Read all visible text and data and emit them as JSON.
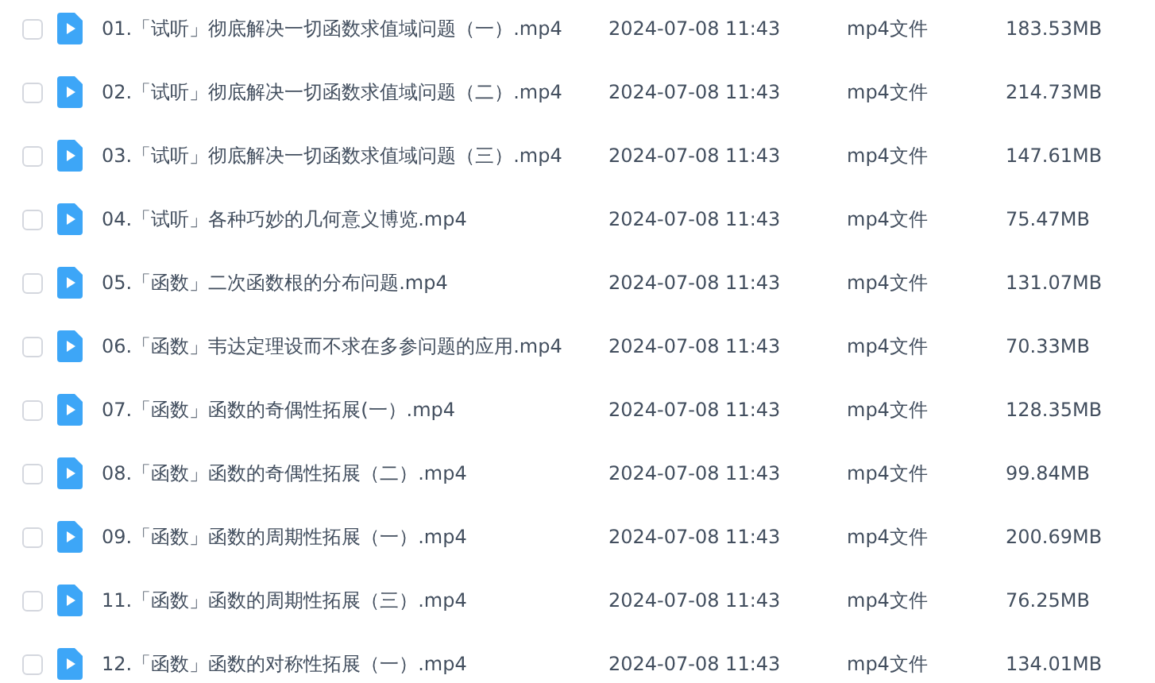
{
  "files": [
    {
      "checked": false,
      "name": "01.「试听」彻底解决一切函数求值域问题（一）.mp4",
      "modified": "2024-07-08 11:43",
      "type": "mp4文件",
      "size": "183.53MB"
    },
    {
      "checked": false,
      "name": "02.「试听」彻底解决一切函数求值域问题（二）.mp4",
      "modified": "2024-07-08 11:43",
      "type": "mp4文件",
      "size": "214.73MB"
    },
    {
      "checked": false,
      "name": "03.「试听」彻底解决一切函数求值域问题（三）.mp4",
      "modified": "2024-07-08 11:43",
      "type": "mp4文件",
      "size": "147.61MB"
    },
    {
      "checked": false,
      "name": "04.「试听」各种巧妙的几何意义博览.mp4",
      "modified": "2024-07-08 11:43",
      "type": "mp4文件",
      "size": "75.47MB"
    },
    {
      "checked": false,
      "name": "05.「函数」二次函数根的分布问题.mp4",
      "modified": "2024-07-08 11:43",
      "type": "mp4文件",
      "size": "131.07MB"
    },
    {
      "checked": false,
      "name": "06.「函数」韦达定理设而不求在多参问题的应用.mp4",
      "modified": "2024-07-08 11:43",
      "type": "mp4文件",
      "size": "70.33MB"
    },
    {
      "checked": false,
      "name": "07.「函数」函数的奇偶性拓展(一）.mp4",
      "modified": "2024-07-08 11:43",
      "type": "mp4文件",
      "size": "128.35MB"
    },
    {
      "checked": false,
      "name": "08.「函数」函数的奇偶性拓展（二）.mp4",
      "modified": "2024-07-08 11:43",
      "type": "mp4文件",
      "size": "99.84MB"
    },
    {
      "checked": false,
      "name": "09.「函数」函数的周期性拓展（一）.mp4",
      "modified": "2024-07-08 11:43",
      "type": "mp4文件",
      "size": "200.69MB"
    },
    {
      "checked": false,
      "name": "11.「函数」函数的周期性拓展（三）.mp4",
      "modified": "2024-07-08 11:43",
      "type": "mp4文件",
      "size": "76.25MB"
    },
    {
      "checked": false,
      "name": "12.「函数」函数的对称性拓展（一）.mp4",
      "modified": "2024-07-08 11:43",
      "type": "mp4文件",
      "size": "134.01MB"
    }
  ]
}
